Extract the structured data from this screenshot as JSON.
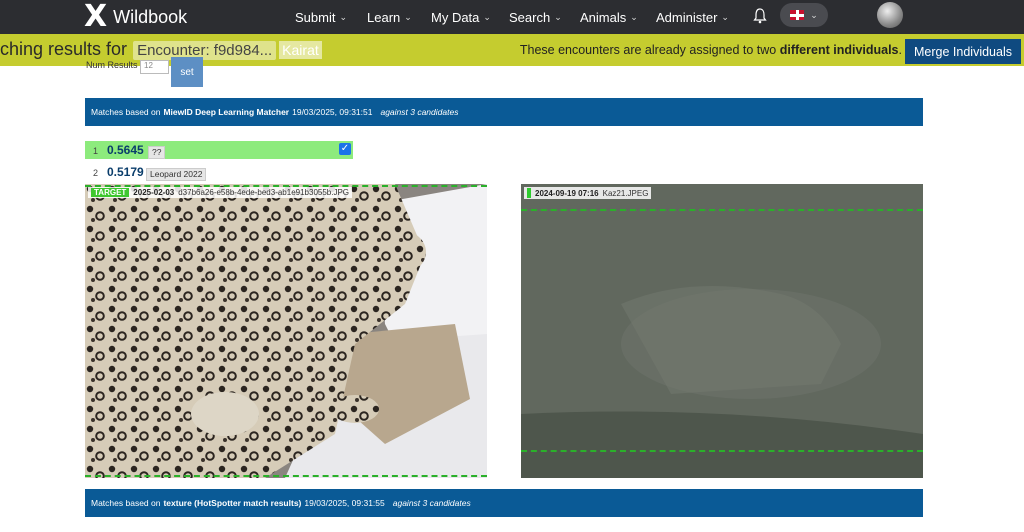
{
  "nav": {
    "brand": "Wildbook",
    "logo_glyph": "X",
    "items": [
      {
        "label": "Submit"
      },
      {
        "label": "Learn"
      },
      {
        "label": "My Data"
      },
      {
        "label": "Search"
      },
      {
        "label": "Animals"
      },
      {
        "label": "Administer"
      }
    ],
    "chevron": "⌄",
    "bell": "🔔"
  },
  "banner": {
    "title": "ching results for",
    "encounter_chip": "Encounter: f9d984...",
    "individual_chip": "Kairat",
    "message_prefix": "These encounters are already assigned to two ",
    "message_bold": "different individuals",
    "message_suffix": ".",
    "merge_label": "Merge Individuals"
  },
  "controls": {
    "num_results_label": "Num Results",
    "num_results_value": "12",
    "set_label": "set"
  },
  "match_sections": [
    {
      "prefix": "Matches based on",
      "algorithm": "MiewID Deep Learning Matcher",
      "timestamp": "19/03/2025, 09:31:51",
      "candidates": "against 3 candidates"
    },
    {
      "prefix": "Matches based on",
      "algorithm": "texture (HotSpotter match results)",
      "timestamp": "19/03/2025, 09:31:55",
      "candidates": "against 3 candidates"
    }
  ],
  "results": [
    {
      "rank": "1",
      "score": "0.5645",
      "label": "??",
      "checked": true
    },
    {
      "rank": "2",
      "score": "0.5179",
      "label": "Leopard 2022",
      "checked": false
    }
  ],
  "images": {
    "target": {
      "tag": "TARGET",
      "date": "2025-02-03",
      "filename": "d37b6a26-e58b-4ede-bed3-ab1e91b3055b.JPG"
    },
    "candidate": {
      "date": "2024-09-19 07:16",
      "filename": "Kaz21.JPEG"
    }
  },
  "colors": {
    "topnav": "#2c2d31",
    "banner": "#c5cc2f",
    "accent_blue": "#0a5a96",
    "match_green": "#8deb7d"
  }
}
